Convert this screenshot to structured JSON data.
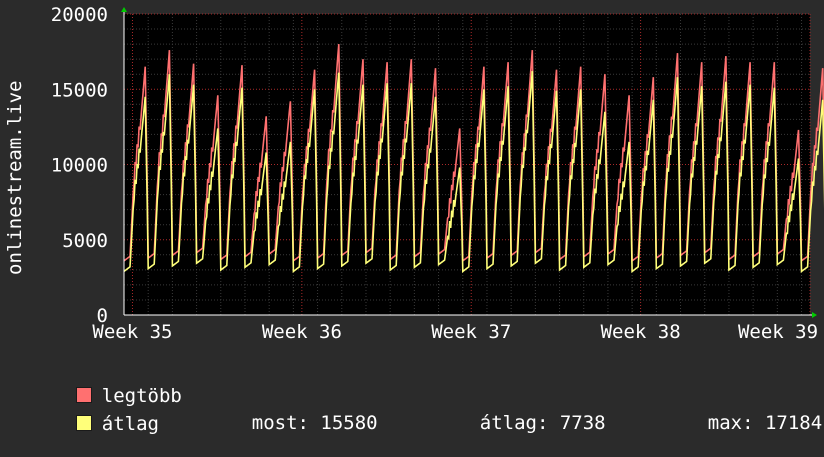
{
  "chart_data": {
    "type": "line",
    "ylabel": "onlinestream.live",
    "ylim": [
      0,
      20000
    ],
    "y_ticks": [
      "0",
      "5000",
      "10000",
      "15000",
      "20000"
    ],
    "x_tick_labels": [
      "Week 35",
      "Week 36",
      "Week 37",
      "Week 38",
      "Week 39"
    ],
    "x_range_weeks": [
      34.95,
      39.0
    ],
    "grid": true,
    "legend_placement": "bottom-left",
    "series": [
      {
        "name": "legtöbb",
        "color": "#ff7070",
        "daily_peaks": [
          16500,
          17600,
          16700,
          14600,
          16600,
          13200,
          14200,
          16300,
          18000,
          17000,
          16800,
          17000,
          16400,
          12400,
          16500,
          16800,
          17600,
          16300,
          16500,
          16000,
          14600,
          15800,
          17400,
          16800,
          17200,
          16800,
          16800,
          12300,
          16400,
          17000,
          16600,
          16400,
          16100,
          15800,
          12700,
          17600,
          17000,
          17400,
          16600,
          16600,
          13400,
          15000
        ]
      },
      {
        "name": "átlag",
        "color": "#ffff7a",
        "daily_peaks": [
          14500,
          16000,
          15300,
          12400,
          15100,
          10800,
          11500,
          15000,
          16100,
          15300,
          15400,
          15400,
          14500,
          9800,
          15000,
          15200,
          16200,
          14900,
          15000,
          13500,
          11500,
          14300,
          15800,
          15200,
          15500,
          15300,
          15100,
          10400,
          14300,
          15600,
          15300,
          15400,
          14900,
          14300,
          10900,
          16000,
          15600,
          15900,
          15100,
          15400,
          11300,
          15580
        ]
      }
    ],
    "stats": {
      "most_label": "most:",
      "most_value": "15580",
      "atlag_label": "átlag:",
      "atlag_value": "7738",
      "max_label": "max:",
      "max_value": "17184"
    }
  },
  "colors": {
    "background": "#2b2b2b",
    "plot_background": "#000000",
    "grid_minor": "#3a3a3a",
    "grid_major": "#aa2a2a",
    "axis": "#ffffff",
    "arrow": "#00cc00"
  }
}
